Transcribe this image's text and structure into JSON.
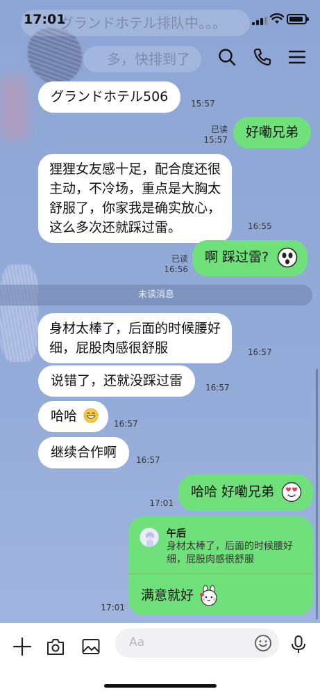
{
  "status_bar": {
    "time": "17:01"
  },
  "ghost": {
    "line1": "グランドホテル排队中。。。",
    "line2": "多，快排到了"
  },
  "messages": [
    {
      "dir": "in",
      "text": "グランドホテル506",
      "time": "15:57"
    },
    {
      "dir": "out",
      "text": "好嘞兄弟",
      "read": "已读",
      "time": "15:57"
    },
    {
      "dir": "in",
      "lines": [
        "狸狸女友感十足，配合度还很",
        "主动，不冷场，重点是大胸太",
        "舒服了，你家我是确实放心，",
        "这么多次还就踩过雷。"
      ],
      "time": "16:55"
    },
    {
      "dir": "out",
      "text": "啊 踩过雷?",
      "read": "已读",
      "time": "16:56"
    },
    {
      "dir": "in",
      "lines": [
        "身材太棒了，后面的时候腰好",
        "细，屁股肉感很舒服"
      ],
      "time": "16:57"
    },
    {
      "dir": "in",
      "text": "说错了，还就没踩过雷",
      "time": "16:57"
    },
    {
      "dir": "in",
      "text": "哈哈",
      "time": "16:57"
    },
    {
      "dir": "in",
      "text": "继续合作啊",
      "time": "16:57"
    },
    {
      "dir": "out",
      "text": "哈哈 好嘞兄弟",
      "time": "17:01"
    }
  ],
  "divider": "未读消息",
  "reply": {
    "name": "午后",
    "quoted": "身材太棒了，后面的时候腰好细，屁股肉感很舒服",
    "text": "满意就好",
    "time": "17:01"
  },
  "composer": {
    "placeholder": "Aa"
  },
  "icons": {
    "header": [
      "search-icon",
      "phone-icon",
      "menu-icon"
    ],
    "bottom": [
      "plus-icon",
      "camera-icon",
      "image-icon",
      "emoji-icon",
      "microphone-icon"
    ]
  },
  "colors": {
    "background": "#8fa7d6",
    "incoming_bubble": "#ffffff",
    "outgoing_bubble": "#6fe07a"
  }
}
